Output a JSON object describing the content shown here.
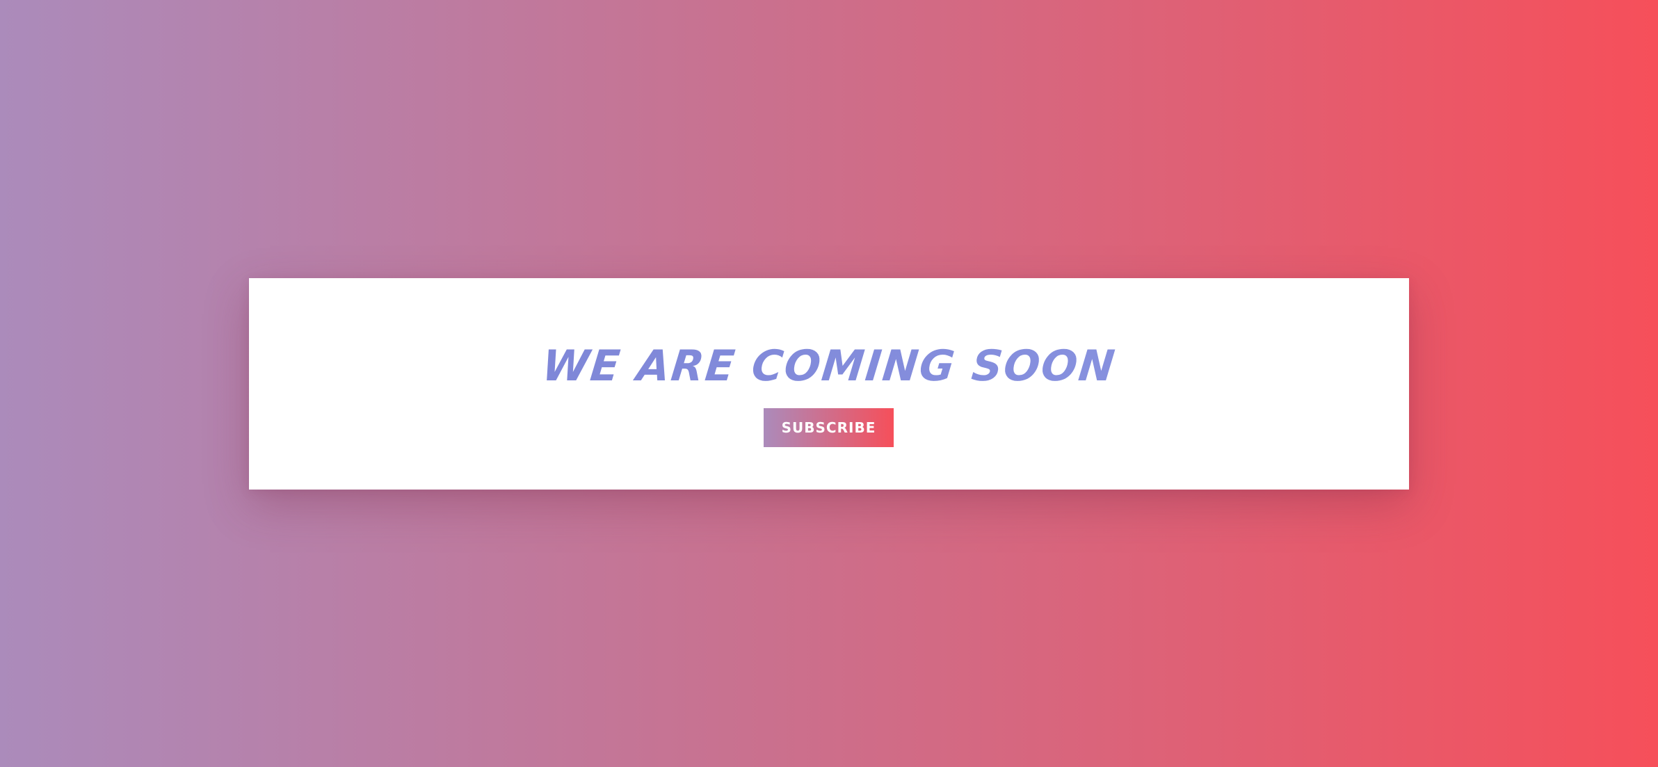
{
  "colors": {
    "background_gradient_start": "#ab8bbb",
    "background_gradient_end": "#f64f5a",
    "headline": "#8890dd",
    "card": "#ffffff",
    "button_text": "#ffffff"
  },
  "hero": {
    "title": "WE ARE COMING SOON"
  },
  "cta": {
    "subscribe_label": "SUBSCRIBE"
  }
}
